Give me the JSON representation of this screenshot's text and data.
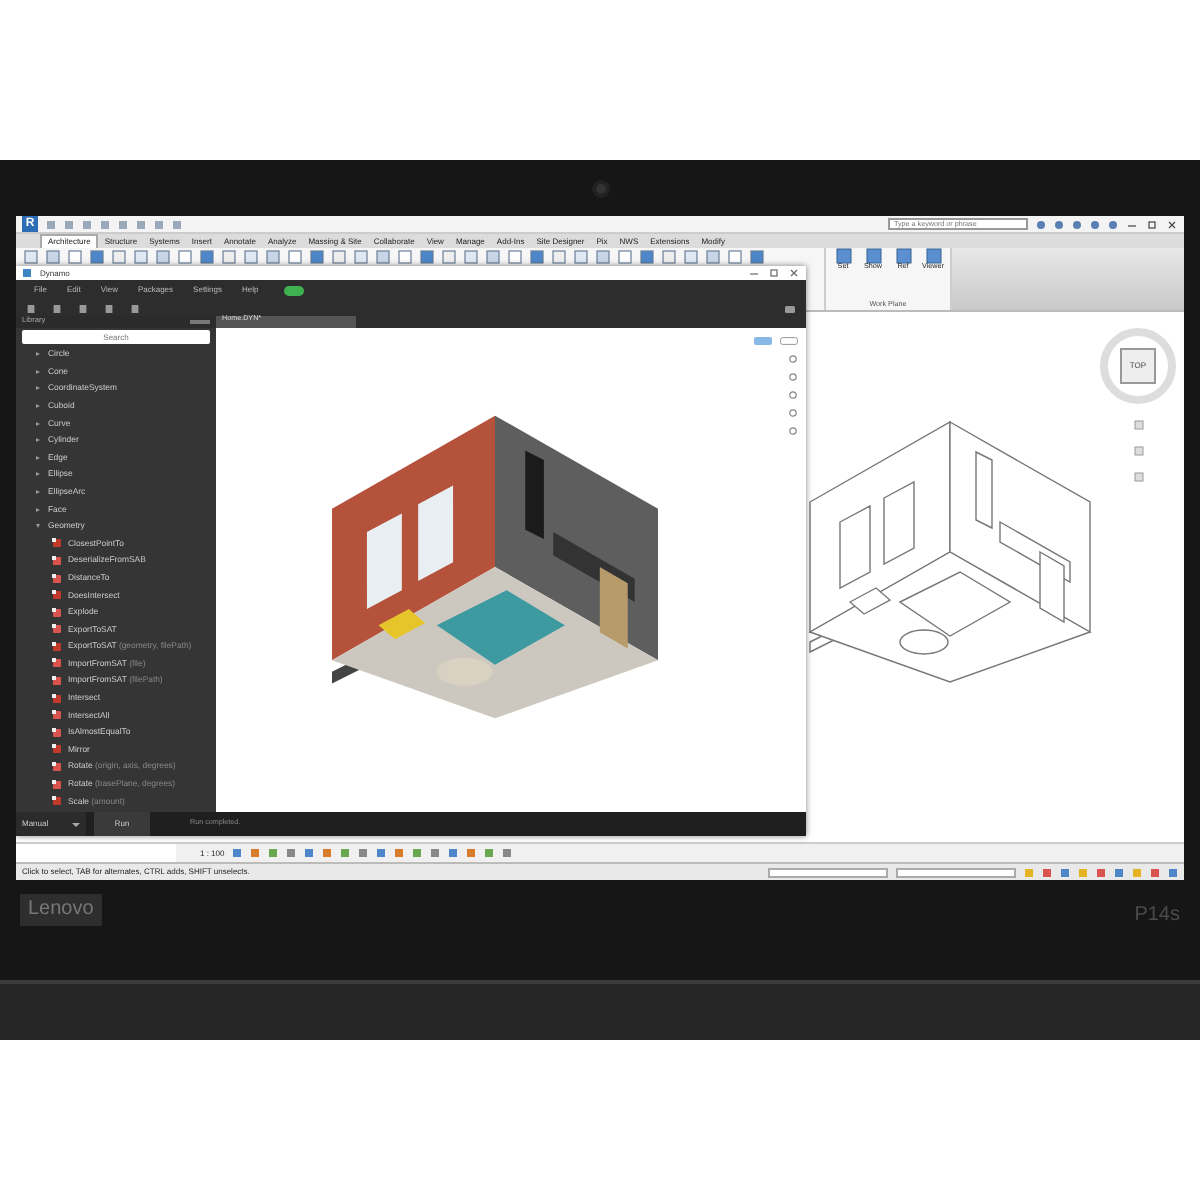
{
  "revit": {
    "app_logo": "R",
    "search": {
      "placeholder": "Type a keyword or phrase"
    },
    "ribbon_tabs": [
      {
        "label": "Architecture",
        "selected": true
      },
      {
        "label": "Structure",
        "selected": false
      },
      {
        "label": "Systems",
        "selected": false
      },
      {
        "label": "Insert",
        "selected": false
      },
      {
        "label": "Annotate",
        "selected": false
      },
      {
        "label": "Analyze",
        "selected": false
      },
      {
        "label": "Massing & Site",
        "selected": false
      },
      {
        "label": "Collaborate",
        "selected": false
      },
      {
        "label": "View",
        "selected": false
      },
      {
        "label": "Manage",
        "selected": false
      },
      {
        "label": "Add-Ins",
        "selected": false
      },
      {
        "label": "Site Designer",
        "selected": false
      },
      {
        "label": "Pix",
        "selected": false
      },
      {
        "label": "NWS",
        "selected": false
      },
      {
        "label": "Extensions",
        "selected": false
      },
      {
        "label": "Modify",
        "selected": false
      }
    ],
    "work_plane_panel": {
      "title": "Work Plane",
      "buttons": [
        "Set",
        "Show",
        "Ref",
        "Viewer"
      ]
    },
    "view_cube": {
      "label": "TOP"
    },
    "view_scale": "1 : 100",
    "status_bar": "Click to select, TAB for alternates, CTRL adds, SHIFT unselects."
  },
  "dynamo": {
    "title": "Dynamo",
    "menu": [
      "File",
      "Edit",
      "View",
      "Packages",
      "Settings",
      "Help"
    ],
    "menu_toggle": {
      "on": true
    },
    "library": {
      "title": "Library",
      "search_placeholder": "Search",
      "items": [
        {
          "label": "Circle",
          "expanded": false
        },
        {
          "label": "Cone",
          "expanded": false
        },
        {
          "label": "CoordinateSystem",
          "expanded": false
        },
        {
          "label": "Cuboid",
          "expanded": false
        },
        {
          "label": "Curve",
          "expanded": false
        },
        {
          "label": "Cylinder",
          "expanded": false
        },
        {
          "label": "Edge",
          "expanded": false
        },
        {
          "label": "Ellipse",
          "expanded": false
        },
        {
          "label": "EllipseArc",
          "expanded": false
        },
        {
          "label": "Face",
          "expanded": false
        },
        {
          "label": "Geometry",
          "expanded": true,
          "children": [
            {
              "label": "ClosestPointTo"
            },
            {
              "label": "DeserializeFromSAB"
            },
            {
              "label": "DistanceTo"
            },
            {
              "label": "DoesIntersect"
            },
            {
              "label": "Explode"
            },
            {
              "label": "ExportToSAT"
            },
            {
              "label": "ExportToSAT",
              "params": "(geometry, filePath)"
            },
            {
              "label": "ImportFromSAT",
              "params": "(file)"
            },
            {
              "label": "ImportFromSAT",
              "params": "(filePath)"
            },
            {
              "label": "Intersect"
            },
            {
              "label": "IntersectAll"
            },
            {
              "label": "IsAlmostEqualTo"
            },
            {
              "label": "Mirror"
            },
            {
              "label": "Rotate",
              "params": "(origin, axis, degrees)"
            },
            {
              "label": "Rotate",
              "params": "(basePlane, degrees)"
            },
            {
              "label": "Scale",
              "params": "(amount)"
            }
          ]
        }
      ]
    },
    "tab": {
      "label": "Home.DYN*"
    },
    "run_mode": "Manual",
    "run_button": "Run",
    "run_status": "Run completed."
  },
  "device": {
    "brand": "Lenovo",
    "model": "P14s"
  }
}
